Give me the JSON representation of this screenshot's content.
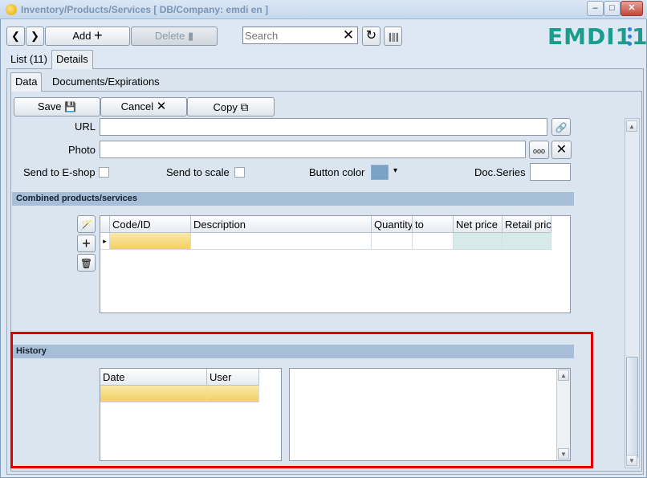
{
  "window": {
    "title": "Inventory/Products/Services   [ DB/Company: emdi en ]",
    "min": "–",
    "max": "□",
    "close": "✕"
  },
  "toolbar": {
    "back": "❮",
    "forward": "❯",
    "add_label": "Add",
    "add_icon": "+",
    "delete_label": "Delete",
    "delete_icon": "▮",
    "search_placeholder": "Search",
    "search_clear": "✕",
    "refresh_icon": "↻",
    "barcode_icon": "║║║",
    "logo": "EMDI11"
  },
  "tabs": {
    "list": "List (11)",
    "details": "Details",
    "data": "Data",
    "documents": "Documents/Expirations"
  },
  "actions": {
    "save": "Save",
    "save_icon": "💾",
    "cancel": "Cancel",
    "cancel_icon": "✕",
    "copy": "Copy",
    "copy_icon": "⧉"
  },
  "form": {
    "url_label": "URL",
    "url_value": "",
    "url_link_icon": "🔗",
    "photo_label": "Photo",
    "photo_value": "",
    "photo_browse": "ooo",
    "photo_clear": "✕",
    "eshop_label": "Send to E-shop",
    "scale_label": "Send to scale",
    "color_label": "Button color",
    "button_color": "#7ba3c8",
    "color_dropdown": "▾",
    "docseries_label": "Doc.Series",
    "docseries_value": ""
  },
  "combined": {
    "title": "Combined products/services",
    "wand_icon": "🪄",
    "add_icon": "+",
    "delete_icon": "🗑",
    "row_marker": "▸",
    "columns": [
      "Code/ID",
      "Description",
      "Quantity",
      "to",
      "Net price",
      "Retail pric"
    ]
  },
  "history": {
    "title": "History",
    "columns": [
      "Date",
      "User"
    ],
    "up": "▲",
    "down": "▼"
  },
  "scrollbar": {
    "up": "▲",
    "down": "▼"
  }
}
